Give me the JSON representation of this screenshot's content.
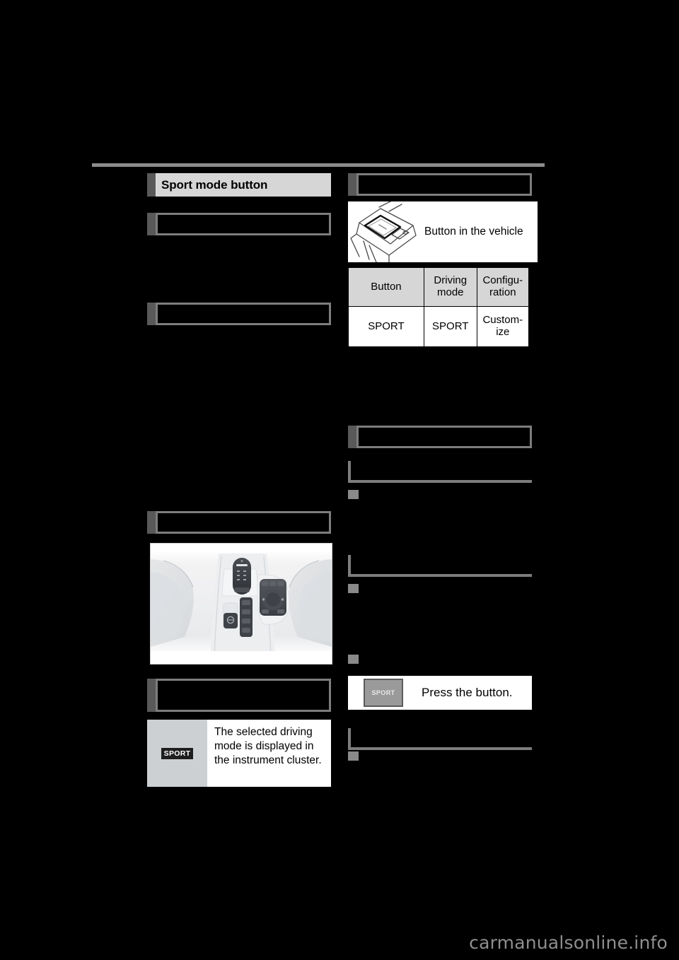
{
  "page": {
    "background_color": "#000000",
    "rule_color": "#8c8c8c",
    "accent_tab_color": "#595959",
    "title_bar_color": "#d6d6d6",
    "redaction_color": "#000000",
    "redaction_border_color": "#7d7d7d",
    "watermark": "carmanualsonline.info"
  },
  "left_column": {
    "section_title": "Sport mode button",
    "redacted_headings": [
      {
        "name": "redacted-heading-1"
      },
      {
        "name": "redacted-heading-2"
      },
      {
        "name": "redacted-heading-3"
      },
      {
        "name": "redacted-heading-4"
      }
    ],
    "console_figure": {
      "alt": "center console with shift lever and drive mode controls"
    },
    "cluster_figure": {
      "badge_label": "SPORT",
      "caption": "The selected driving mode is displayed in the instrument cluster."
    }
  },
  "right_column": {
    "redacted_headings": [
      {
        "name": "redacted-heading-right-1"
      },
      {
        "name": "redacted-heading-right-2"
      }
    ],
    "vehicle_button_figure": {
      "caption": "Button in the vehicle",
      "alt": "illustration of sport mode button location on center console"
    },
    "mode_table": {
      "headers": [
        "Button",
        "Driving mode",
        "Configu- ration"
      ],
      "header_cells": [
        {
          "line1": "Button",
          "line2": ""
        },
        {
          "line1": "Driving",
          "line2": "mode"
        },
        {
          "line1": "Configu-",
          "line2": "ration"
        }
      ],
      "rows": [
        [
          {
            "line1": "SPORT",
            "line2": ""
          },
          {
            "line1": "SPORT",
            "line2": ""
          },
          {
            "line1": "Custom-",
            "line2": "ize"
          }
        ]
      ]
    },
    "press_button_figure": {
      "button_label": "SPORT",
      "caption": "Press the button."
    },
    "notice_brackets": [
      {
        "name": "notice-bracket-1"
      },
      {
        "name": "notice-bracket-2"
      },
      {
        "name": "notice-bracket-3"
      }
    ],
    "square_bullets": [
      {
        "name": "square-bullet-1"
      },
      {
        "name": "square-bullet-2"
      },
      {
        "name": "square-bullet-3"
      },
      {
        "name": "square-bullet-4"
      }
    ]
  }
}
